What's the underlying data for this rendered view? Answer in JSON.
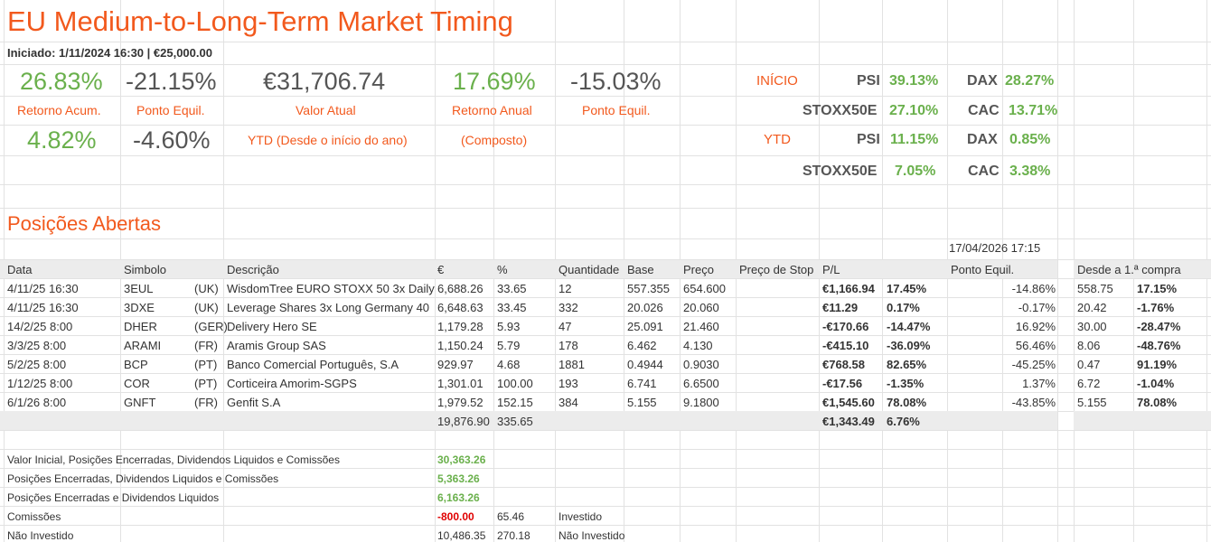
{
  "title": "EU Medium-to-Long-Term Market Timing",
  "subtitle": "Iniciado: 1/11/2024 16:30 |  €25,000.00",
  "stats": {
    "ret_acum": "26.83%",
    "ret_acum_label": "Retorno Acum.",
    "ponto_equil1": "-21.15%",
    "ponto_equil1_label": "Ponto Equil.",
    "valor_atual": "€31,706.74",
    "valor_atual_label": "Valor Atual",
    "ret_anual": "17.69%",
    "ret_anual_label": "Retorno Anual",
    "ponto_equil2": "-15.03%",
    "ponto_equil2_label": "Ponto Equil.",
    "ytd_ret": "4.82%",
    "ytd_pe": "-4.60%",
    "ytd_label": "YTD (Desde o início do ano)",
    "composto_label": "(Composto)"
  },
  "indices": {
    "inicio_label": "INÍCIO",
    "ytd_label": "YTD",
    "psi_label": "PSI",
    "dax_label": "DAX",
    "stoxx_label": "STOXX50E",
    "cac_label": "CAC",
    "inicio_psi": "39.13%",
    "inicio_dax": "28.27%",
    "inicio_stoxx": "27.10%",
    "inicio_cac": "13.71%",
    "ytd_psi": "11.15%",
    "ytd_dax": "0.85%",
    "ytd_stoxx": "7.05%",
    "ytd_cac": "3.38%"
  },
  "positions_title": "Posições Abertas",
  "timestamp": "17/04/2026 17:15",
  "columns": {
    "data": "Data",
    "simbolo": "Simbolo",
    "descricao": "Descrição",
    "eur": "€",
    "pct": "%",
    "quantidade": "Quantidade",
    "base": "Base",
    "preco": "Preço",
    "stop": "Preço de Stop",
    "pl": "P/L",
    "ponto": "Ponto Equil.",
    "desde": "Desde a 1.ª compra"
  },
  "rows": [
    {
      "data": "4/11/25 16:30",
      "sym": "3EUL",
      "mkt": "(UK)",
      "desc": "WisdomTree EURO STOXX 50 3x Daily",
      "eur": "6,688.26",
      "pct": "33.65",
      "qty": "12",
      "base": "557.355",
      "preco": "654.600",
      "pl": "€1,166.94",
      "plpct": "17.45%",
      "ponto": "-14.86%",
      "d1": "558.75",
      "d2": "17.15%",
      "plc": "g",
      "dc": "g"
    },
    {
      "data": "4/11/25 16:30",
      "sym": "3DXE",
      "mkt": "(UK)",
      "desc": "Leverage Shares 3x Long Germany 40",
      "eur": "6,648.63",
      "pct": "33.45",
      "qty": "332",
      "base": "20.026",
      "preco": "20.060",
      "pl": "€11.29",
      "plpct": "0.17%",
      "ponto": "-0.17%",
      "d1": "20.42",
      "d2": "-1.76%",
      "plc": "g",
      "dc": "r"
    },
    {
      "data": "14/2/25 8:00",
      "sym": "DHER",
      "mkt": "(GER)",
      "desc": "Delivery Hero SE",
      "eur": "1,179.28",
      "pct": "5.93",
      "qty": "47",
      "base": "25.091",
      "preco": "21.460",
      "pl": "-€170.66",
      "plpct": "-14.47%",
      "ponto": "16.92%",
      "d1": "30.00",
      "d2": "-28.47%",
      "plc": "r",
      "dc": "r"
    },
    {
      "data": "3/3/25 8:00",
      "sym": "ARAMI",
      "mkt": "(FR)",
      "desc": "Aramis Group SAS",
      "eur": "1,150.24",
      "pct": "5.79",
      "qty": "178",
      "base": "6.462",
      "preco": "4.130",
      "pl": "-€415.10",
      "plpct": "-36.09%",
      "ponto": "56.46%",
      "d1": "8.06",
      "d2": "-48.76%",
      "plc": "r",
      "dc": "r"
    },
    {
      "data": "5/2/25 8:00",
      "sym": "BCP",
      "mkt": "(PT)",
      "desc": "Banco Comercial Português, S.A",
      "eur": "929.97",
      "pct": "4.68",
      "qty": "1881",
      "base": "0.4944",
      "preco": "0.9030",
      "pl": "€768.58",
      "plpct": "82.65%",
      "ponto": "-45.25%",
      "d1": "0.47",
      "d2": "91.19%",
      "plc": "g",
      "dc": "g"
    },
    {
      "data": "1/12/25 8:00",
      "sym": "COR",
      "mkt": "(PT)",
      "desc": "Corticeira Amorim-SGPS",
      "eur": "1,301.01",
      "pct": "100.00",
      "qty": "193",
      "base": "6.741",
      "preco": "6.6500",
      "pl": "-€17.56",
      "plpct": "-1.35%",
      "ponto": "1.37%",
      "d1": "6.72",
      "d2": "-1.04%",
      "plc": "r",
      "dc": "r"
    },
    {
      "data": "6/1/26 8:00",
      "sym": "GNFT",
      "mkt": "(FR)",
      "desc": "Genfit S.A",
      "eur": "1,979.52",
      "pct": "152.15",
      "qty": "384",
      "base": "5.155",
      "preco": "9.1800",
      "pl": "€1,545.60",
      "plpct": "78.08%",
      "ponto": "-43.85%",
      "d1": "5.155",
      "d2": "78.08%",
      "plc": "g",
      "dc": "g"
    }
  ],
  "totals": {
    "eur": "19,876.90",
    "pct": "335.65",
    "pl": "€1,343.49",
    "plpct": "6.76%"
  },
  "summary": [
    {
      "label": "Valor Inicial, Posições Encerradas, Dividendos Liquidos e Comissões",
      "val": "30,363.26"
    },
    {
      "label": "Posições Encerradas, Dividendos Liquidos e Comissões",
      "val": "5,363.26"
    },
    {
      "label": "Posições Encerradas e Dividendos Liquidos",
      "val": "6,163.26"
    },
    {
      "label": "Comissões",
      "val": "-800.00",
      "extra": "65.46",
      "note": "Investido"
    },
    {
      "label": "Não Investido",
      "val": "10,486.35",
      "extra": "270.18",
      "note": "Não Investido"
    }
  ]
}
